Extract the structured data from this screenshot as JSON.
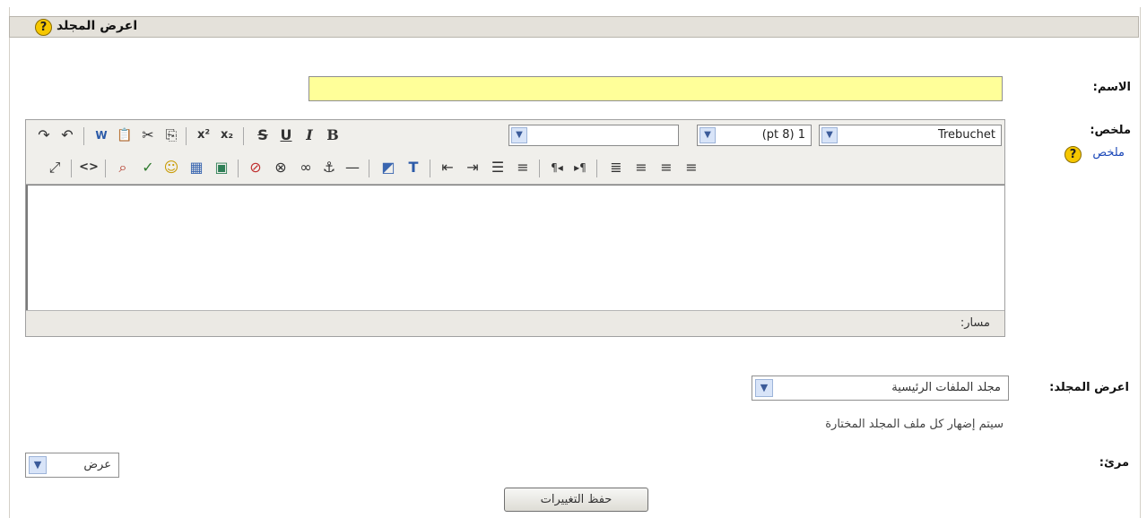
{
  "header": {
    "title": "اعرض المجلد",
    "help_icon": "?"
  },
  "fields": {
    "name_label": "الاسم:",
    "name_value": "",
    "summary_label": "ملخص:",
    "summary_link": "ملخص",
    "summary_help_icon": "?",
    "display_folder_label": "اعرض المجلد:",
    "folder_select_value": "مجلد الملفات الرئيسية",
    "folder_hint": "سيتم إضهار كل ملف المجلد المختارة",
    "visible_label": "مرئ:",
    "visible_select_value": "عرض"
  },
  "editor": {
    "font_family": "Trebuchet",
    "font_size": "(pt 8) 1",
    "format_value": "",
    "path_label": "مسار:",
    "toolbar_row1_icons": [
      "redo-icon",
      "undo-icon",
      "paste-word-icon",
      "paste-icon",
      "cut-icon",
      "copy-icon",
      "superscript-icon",
      "subscript-icon",
      "strikethrough-icon",
      "underline-icon",
      "italic-icon",
      "bold-icon"
    ],
    "toolbar_row2_icons": [
      "fullscreen-icon",
      "html-source-icon",
      "find-replace-icon",
      "spellcheck-icon",
      "smiley-icon",
      "table-icon",
      "image-icon",
      "unlink-icon",
      "nolink-icon",
      "link-icon",
      "anchor-icon",
      "horizontal-rule-icon",
      "background-color-icon",
      "text-color-icon",
      "outdent-icon",
      "indent-icon",
      "unordered-list-icon",
      "ordered-list-icon",
      "rtl-icon",
      "ltr-icon",
      "justify-full-icon",
      "align-right-icon",
      "align-center-icon",
      "align-left-icon"
    ],
    "glyphs": {
      "redo": "↷",
      "undo": "↶",
      "paste_word": "W",
      "paste": "📋",
      "cut": "✂",
      "copy": "⎘",
      "superscript": "x²",
      "subscript": "x₂",
      "strike": "S",
      "underline": "U",
      "italic": "I",
      "bold": "B",
      "fullscreen": "⤢",
      "source": "<>",
      "find": "⌕",
      "spell": "✓",
      "smiley": "☺",
      "table": "▦",
      "image": "▣",
      "unlink": "⊘",
      "nolink": "⊗",
      "link": "∞",
      "anchor": "⚓",
      "hr": "—",
      "bgcolor": "◩",
      "textcolor": "T",
      "outdent": "⇤",
      "indent": "⇥",
      "ul": "☰",
      "ol": "≡",
      "rtl": "¶◂",
      "ltr": "▸¶",
      "justify": "≣",
      "aright": "≡",
      "acenter": "≡",
      "aleft": "≡"
    }
  },
  "actions": {
    "save_label": "حفظ التغييرات"
  },
  "colors": {
    "name_field_bg": "#ffff99",
    "help_icon": "#f6c700",
    "link": "#1a47b8",
    "header_bar": "#e4e1da"
  }
}
